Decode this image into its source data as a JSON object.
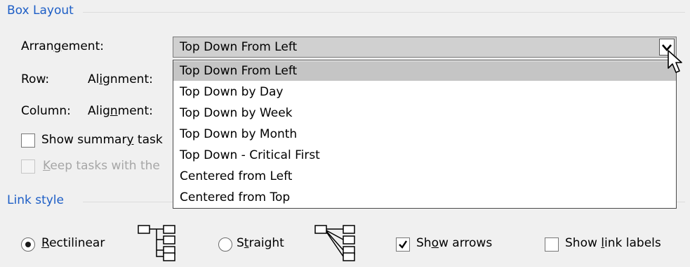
{
  "box_layout": {
    "title": "Box Layout",
    "arrangement_label": "Arrangement:",
    "row_label": "Row:",
    "row_alignment_label": "Alignment:",
    "column_label": "Column:",
    "column_alignment_label": "Alignment:",
    "show_summary_label": "Show summary task",
    "keep_tasks_label": "Keep tasks with the"
  },
  "arrangement_combo": {
    "value": "Top Down From Left",
    "options": [
      "Top Down From Left",
      "Top Down by Day",
      "Top Down by Week",
      "Top Down by Month",
      "Top Down - Critical First",
      "Centered from Left",
      "Centered from Top"
    ],
    "selected_index": 0
  },
  "link_style": {
    "title": "Link style",
    "rectilinear_label": "Rectilinear",
    "straight_label": "Straight",
    "show_arrows_label": "Show arrows",
    "show_link_labels_label": "Show link labels",
    "rectilinear_checked": true,
    "show_arrows_checked": true,
    "show_link_labels_checked": false
  },
  "icons": {
    "rectilinear_preview": "rectilinear-link-icon",
    "straight_preview": "straight-link-icon",
    "cursor": "mouse-pointer-icon"
  }
}
